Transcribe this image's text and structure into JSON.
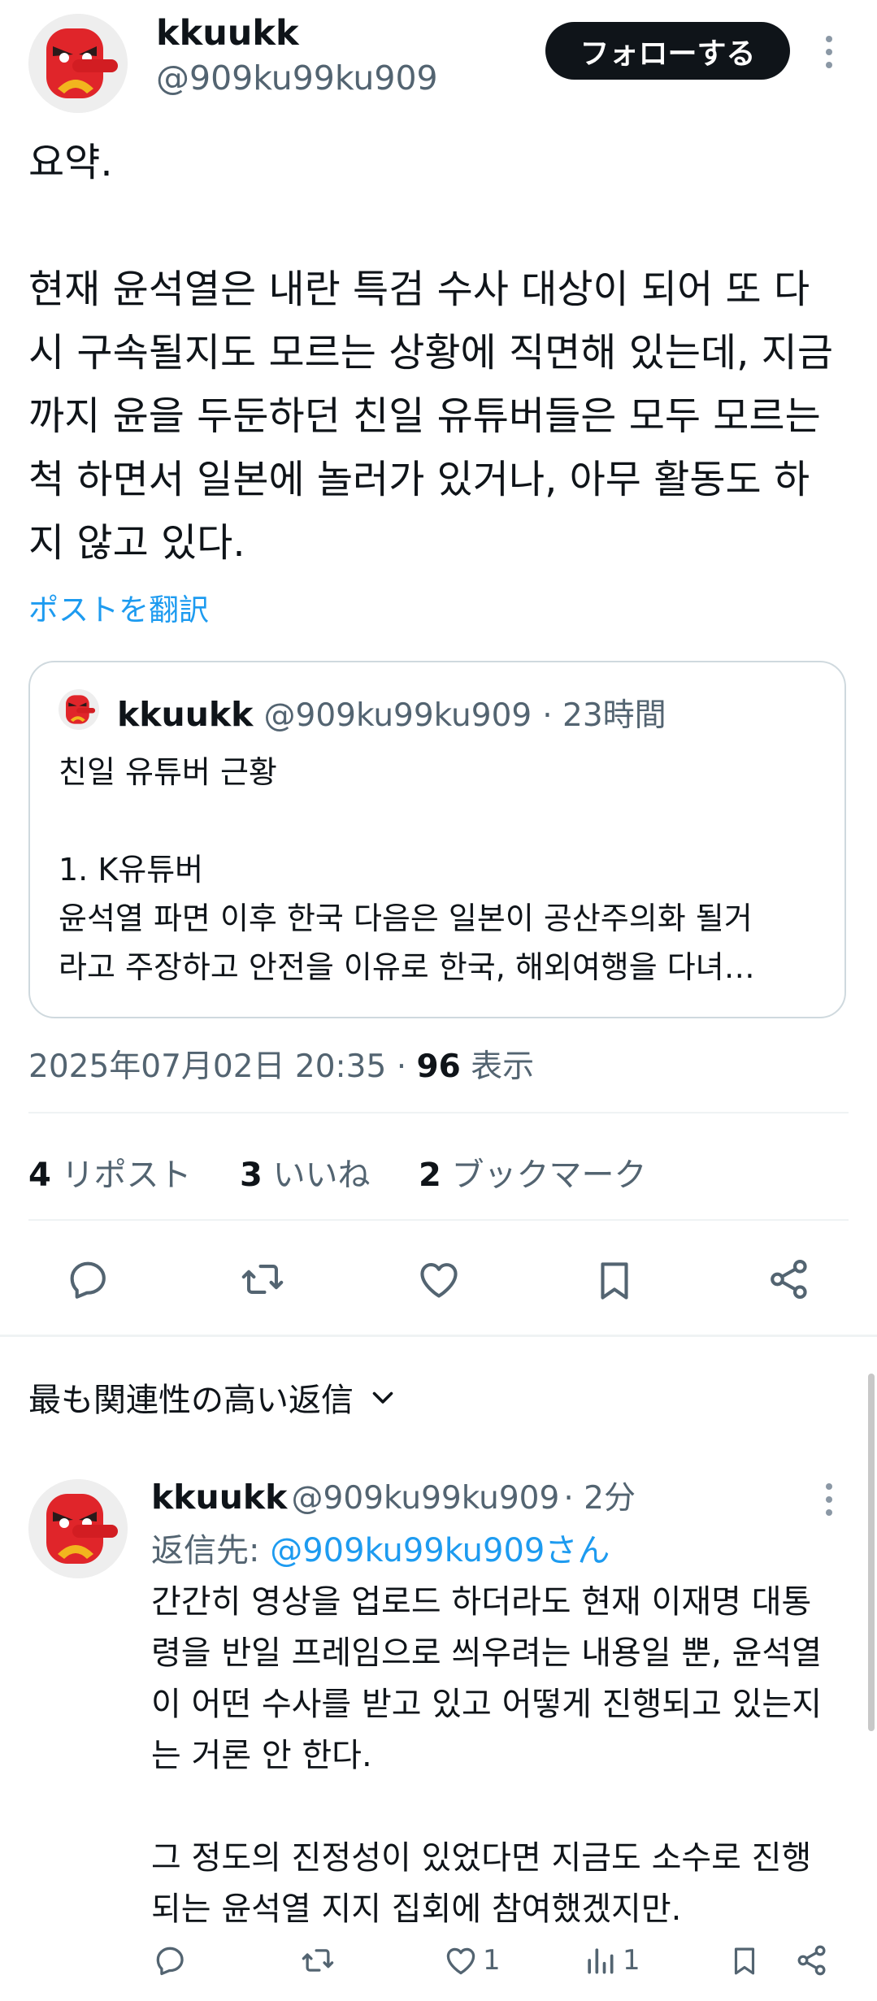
{
  "tweet": {
    "author_name": "kkuukk",
    "author_handle": "@909ku99ku909",
    "follow_label": "フォローする",
    "body": "요약.\n\n현재 윤석열은 내란 특검 수사 대상이 되어 또 다\n시 구속될지도 모르는 상황에 직면해 있는데, 지금\n까지 윤을 두둔하던 친일 유튜버들은 모두 모르는\n척 하면서 일본에 놀러가 있거나, 아무 활동도 하\n지 않고 있다.",
    "translate_label": "ポストを翻訳",
    "quote": {
      "author_name": "kkuukk",
      "author_handle": "@909ku99ku909",
      "time": "· 23時間",
      "text": "친일 유튜버 근황\n\n1. K유튜버\n윤석열 파면 이후 한국 다음은 일본이 공산주의화 될거\n라고 주장하고 안전을 이유로 한국, 해외여행을 다녀…"
    },
    "timestamp": "2025年07月02日 20:35 · ",
    "views_count": "96",
    "views_label": " 表示",
    "stats": {
      "reposts_count": "4",
      "reposts_label": "リポスト",
      "likes_count": "3",
      "likes_label": "いいね",
      "bookmarks_count": "2",
      "bookmarks_label": "ブックマーク"
    }
  },
  "replies_header": {
    "label": "最も関連性の高い返信"
  },
  "reply": {
    "author_name": "kkuukk",
    "author_handle": "@909ku99ku909",
    "time": "· 2分",
    "reply_to_prefix": "返信先: ",
    "reply_to_handle": "@909ku99ku909さん",
    "text": "간간히 영상을 업로드 하더라도 현재 이재명 대통\n령을 반일 프레임으로 씌우려는 내용일 뿐, 윤석열\n이 어떤 수사를 받고 있고 어떻게 진행되고 있는지\n는 거론 안 한다.\n\n그 정도의 진정성이 있었다면 지금도 소수로 진행\n되는 윤석열 지지 집회에 참여했겠지만.",
    "likes_count": "1",
    "views_count": "1"
  },
  "icons": {
    "reply": "reply-icon",
    "repost": "repost-icon",
    "like": "heart-icon",
    "bookmark": "bookmark-icon",
    "share": "share-icon",
    "views": "views-icon",
    "more": "more-icon",
    "chevron": "chevron-down-icon"
  },
  "colors": {
    "accent": "#1d9bf0",
    "text": "#0f1419",
    "secondary": "#536471",
    "avatar_red": "#e0252a"
  }
}
